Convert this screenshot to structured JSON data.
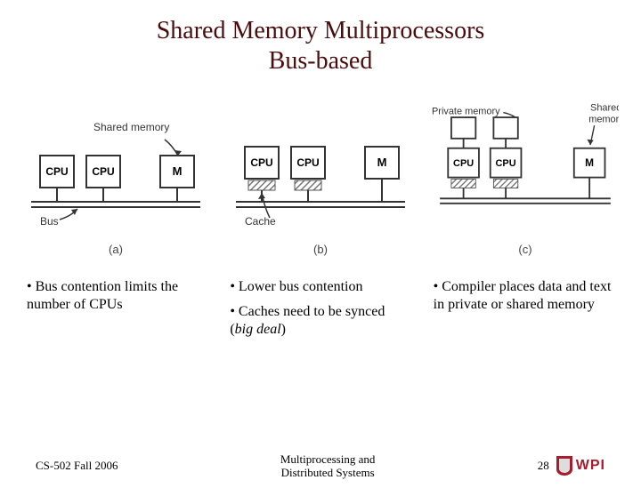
{
  "title_line1": "Shared Memory Multiprocessors",
  "title_line2": "Bus-based",
  "diagrams": {
    "shared_memory_label": "Shared memory",
    "private_memory_label": "Private memory",
    "shared_memory_label_r": "Shared\nmemory",
    "cpu_label": "CPU",
    "mem_label": "M",
    "bus_label": "Bus",
    "cache_label": "Cache",
    "sub_a": "(a)",
    "sub_b": "(b)",
    "sub_c": "(c)"
  },
  "captions": {
    "a": {
      "p1": "• Bus contention limits the number of CPUs"
    },
    "b": {
      "p1": "• Lower bus contention",
      "p2_prefix": "• Caches need to be synced (",
      "p2_em": "big deal",
      "p2_suffix": ")"
    },
    "c": {
      "p1": "• Compiler places data and text in private or shared memory"
    }
  },
  "footer": {
    "left": "CS-502 Fall 2006",
    "center_l1": "Multiprocessing and",
    "center_l2": "Distributed Systems",
    "page": "28",
    "logo_text": "WPI"
  }
}
